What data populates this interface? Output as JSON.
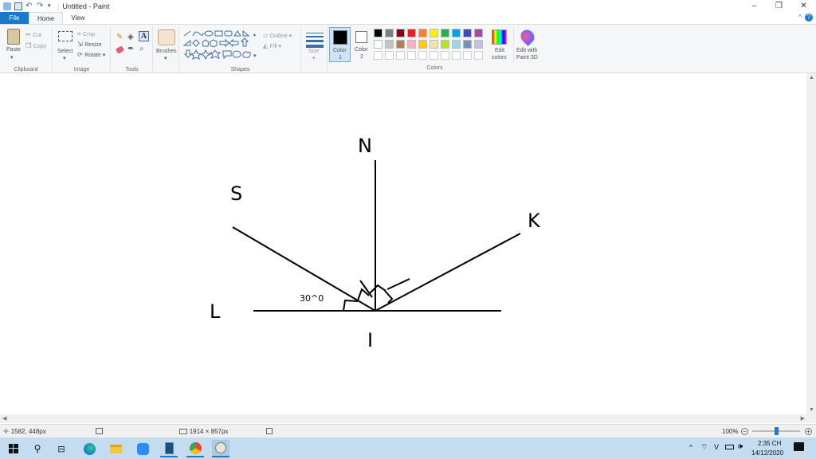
{
  "window": {
    "title": "Untitled - Paint",
    "minimize": "–",
    "maximize": "❐",
    "close": "✕"
  },
  "tabs": [
    {
      "label": "File"
    },
    {
      "label": "Home"
    },
    {
      "label": "View"
    }
  ],
  "help_label": "?",
  "ribbon": {
    "clipboard": {
      "label": "Clipboard",
      "paste": "Paste",
      "cut": "Cut",
      "copy": "Copy"
    },
    "image": {
      "label": "Image",
      "select": "Select",
      "crop": "Crop",
      "resize": "Resize",
      "rotate": "Rotate ▾"
    },
    "tools": {
      "label": "Tools"
    },
    "brushes": {
      "label": "Brushes"
    },
    "shapes": {
      "label": "Shapes",
      "outline": "Outline ▾",
      "fill": "Fill ▾"
    },
    "size": {
      "label": "Size"
    },
    "color1": {
      "label": "Color",
      "sub": "1"
    },
    "color2": {
      "label": "Color",
      "sub": "2"
    },
    "colors": {
      "label": "Colors"
    },
    "edit_colors": {
      "line1": "Edit",
      "line2": "colors"
    },
    "paint3d": {
      "line1": "Edit with",
      "line2": "Paint 3D"
    },
    "palette_row1": [
      "#000000",
      "#7f7f7f",
      "#880015",
      "#ed1c24",
      "#ff7f27",
      "#fff200",
      "#22b14c",
      "#00a2e8",
      "#3f48cc",
      "#a349a4"
    ],
    "palette_row2": [
      "#ffffff",
      "#c3c3c3",
      "#b97a57",
      "#ffaec9",
      "#ffc90e",
      "#efe4b0",
      "#b5e61d",
      "#99d9ea",
      "#7092be",
      "#c8bfe7"
    ]
  },
  "drawing": {
    "labels": {
      "n": "N",
      "s": "S",
      "k": "K",
      "l": "L",
      "i": "I",
      "angle": "30^0"
    }
  },
  "status": {
    "cursor_pos": "1582, 448px",
    "image_size": "1914 × 857px",
    "zoom": "100%"
  },
  "taskbar": {
    "time": "2:35 CH",
    "date": "14/12/2020",
    "lang": "V"
  }
}
